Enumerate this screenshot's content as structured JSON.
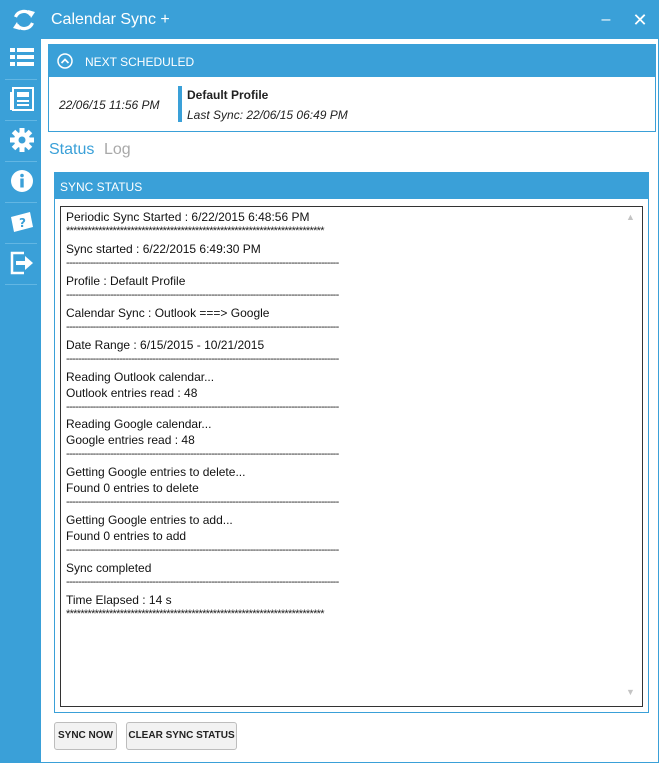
{
  "window": {
    "title": "Calendar Sync +",
    "minimize_glyph": "–",
    "close_glyph": "✕"
  },
  "sidebar": {
    "items": [
      {
        "icon": "list-icon"
      },
      {
        "icon": "newspaper-icon"
      },
      {
        "icon": "gear-icon"
      },
      {
        "icon": "info-icon"
      },
      {
        "icon": "help-book-icon"
      },
      {
        "icon": "exit-icon"
      }
    ]
  },
  "next_scheduled": {
    "header": "NEXT SCHEDULED",
    "time": "22/06/15 11:56 PM",
    "profile": "Default Profile",
    "last_sync": "Last Sync: 22/06/15 06:49 PM"
  },
  "tabs": {
    "status": "Status",
    "log": "Log"
  },
  "sync_status": {
    "header": "SYNC STATUS",
    "lines": [
      "Periodic Sync Started : 6/22/2015 6:48:56 PM",
      "************************************************************************",
      "Sync started : 6/22/2015 6:49:30 PM",
      "--------------------------------------------------------------------------------------------",
      "Profile : Default Profile",
      "--------------------------------------------------------------------------------------------",
      "Calendar Sync : Outlook ===> Google",
      "--------------------------------------------------------------------------------------------",
      "Date Range : 6/15/2015 - 10/21/2015",
      "--------------------------------------------------------------------------------------------",
      "Reading Outlook calendar...",
      "Outlook entries read : 48",
      "--------------------------------------------------------------------------------------------",
      "Reading Google calendar...",
      "Google entries read : 48",
      "--------------------------------------------------------------------------------------------",
      "Getting Google entries to delete...",
      "Found 0 entries to delete",
      "--------------------------------------------------------------------------------------------",
      "Getting Google entries to add...",
      "Found 0 entries to add",
      "--------------------------------------------------------------------------------------------",
      "Sync completed",
      "--------------------------------------------------------------------------------------------",
      "Time Elapsed : 14 s",
      "************************************************************************"
    ]
  },
  "buttons": {
    "sync_now": "SYNC NOW",
    "clear": "CLEAR SYNC STATUS"
  },
  "colors": {
    "accent": "#3aa0d8",
    "inactive_tab": "#a9a9a9"
  }
}
